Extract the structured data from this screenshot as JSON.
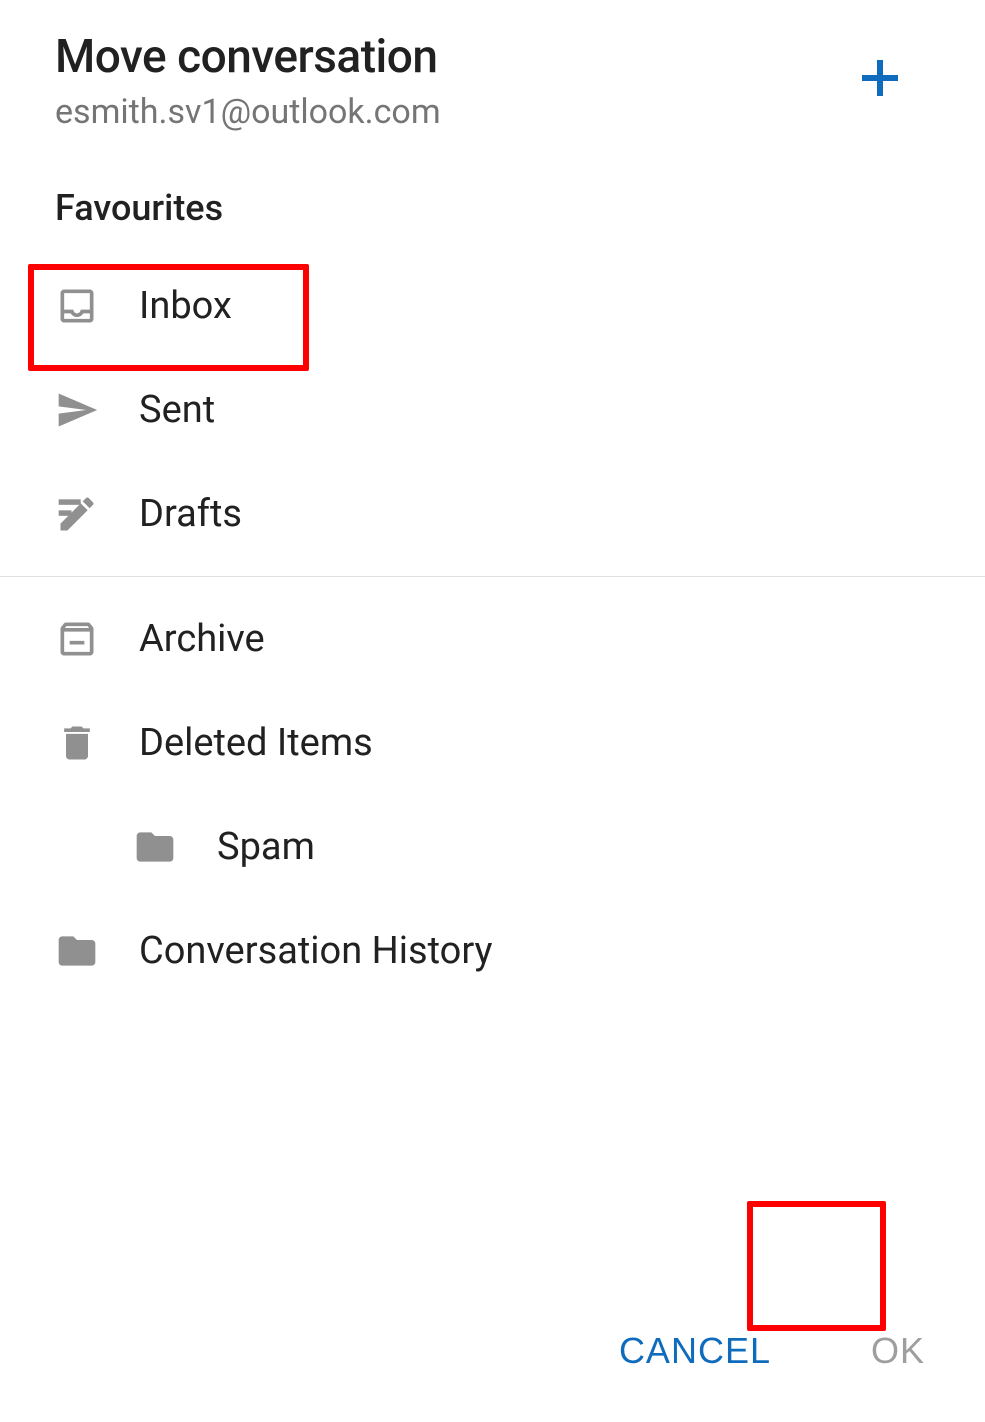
{
  "header": {
    "title": "Move conversation",
    "subtitle": "esmith.sv1@outlook.com"
  },
  "sections": {
    "favourites_label": "Favourites"
  },
  "folders": {
    "favourites": [
      {
        "label": "Inbox",
        "icon": "inbox"
      },
      {
        "label": "Sent",
        "icon": "sent"
      },
      {
        "label": "Drafts",
        "icon": "drafts"
      }
    ],
    "others": [
      {
        "label": "Archive",
        "icon": "archive"
      },
      {
        "label": "Deleted Items",
        "icon": "trash"
      },
      {
        "label": "Spam",
        "icon": "folder",
        "indented": true
      },
      {
        "label": "Conversation History",
        "icon": "folder"
      }
    ]
  },
  "buttons": {
    "cancel": "CANCEL",
    "ok": "OK"
  },
  "colors": {
    "accent": "#0f6cbd",
    "icon_grey": "#909090",
    "highlight": "#ff0000"
  }
}
